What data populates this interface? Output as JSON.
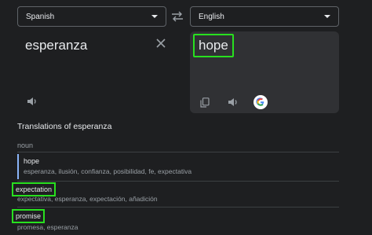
{
  "source_lang": {
    "label": "Spanish"
  },
  "target_lang": {
    "label": "English"
  },
  "source": {
    "text": "esperanza"
  },
  "target": {
    "text": "hope"
  },
  "translations": {
    "heading": "Translations of esperanza",
    "part_of_speech": "noun",
    "entries": [
      {
        "word": "hope",
        "synonyms": "esperanza, ilusión, confianza, posibilidad, fe, expectativa"
      },
      {
        "word": "expectation",
        "synonyms": "expectativa, esperanza, expectación, añadición"
      },
      {
        "word": "promise",
        "synonyms": "promesa, esperanza"
      }
    ]
  },
  "colors": {
    "highlight": "#28e01f",
    "accent": "#8ab4f8"
  }
}
